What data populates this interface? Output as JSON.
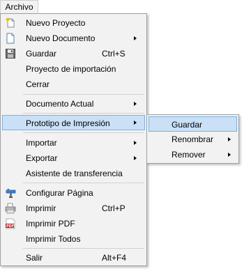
{
  "menubar": {
    "archivo": "Archivo"
  },
  "menu": {
    "nuevo_proyecto": "Nuevo Proyecto",
    "nuevo_documento": "Nuevo Documento",
    "guardar": "Guardar",
    "guardar_shortcut": "Ctrl+S",
    "proyecto_importacion": "Proyecto de importación",
    "cerrar": "Cerrar",
    "documento_actual": "Documento Actual",
    "prototipo_impresion": "Prototipo de Impresión",
    "importar": "Importar",
    "exportar": "Exportar",
    "asistente_transferencia": "Asistente de transferencia",
    "configurar_pagina": "Configurar Página",
    "imprimir": "Imprimir",
    "imprimir_shortcut": "Ctrl+P",
    "imprimir_pdf": "Imprimir PDF",
    "imprimir_todos": "Imprimir Todos",
    "salir": "Salir",
    "salir_shortcut": "Alt+F4"
  },
  "submenu": {
    "guardar": "Guardar",
    "renombrar": "Renombrar",
    "remover": "Remover"
  },
  "icons": {
    "new_project": "new-project-icon",
    "new_document": "new-document-icon",
    "save": "save-icon",
    "page_setup": "page-setup-icon",
    "printer": "printer-icon",
    "pdf": "pdf-icon"
  }
}
